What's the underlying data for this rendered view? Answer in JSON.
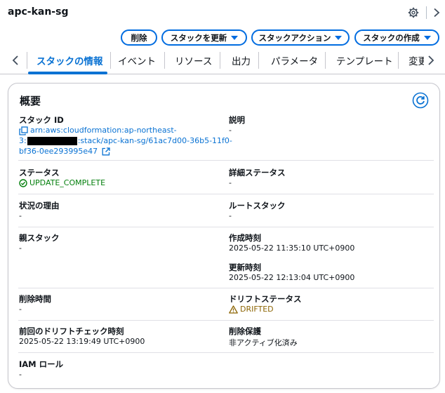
{
  "header": {
    "title": "apc-kan-sg",
    "settings_icon": "gear-icon",
    "next_icon": "chevron-right-icon"
  },
  "actions": {
    "delete": "削除",
    "update": "スタックを更新",
    "stack_actions": "スタックアクション",
    "create": "スタックの作成"
  },
  "tabs": [
    {
      "label": "スタックの情報"
    },
    {
      "label": "イベント"
    },
    {
      "label": "リソース"
    },
    {
      "label": "出力"
    },
    {
      "label": "パラメータ"
    },
    {
      "label": "テンプレート"
    },
    {
      "label": "変更"
    }
  ],
  "overview": {
    "title": "概要",
    "stack_id_label": "スタック ID",
    "stack_id_line1": "arn:aws:cloudformation:ap-northeast-",
    "stack_id_line2_prefix": "3:",
    "stack_id_line2_suffix": ":stack/apc-kan-sg/61ac7d00-36b5-11f0-",
    "stack_id_line3": "bf36-0ee293995e47",
    "description_label": "説明",
    "description_value": "-",
    "status_label": "ステータス",
    "status_value": "UPDATE_COMPLETE",
    "detailed_status_label": "詳細ステータス",
    "detailed_status_value": "-",
    "reason_label": "状況の理由",
    "reason_value": "-",
    "root_stack_label": "ルートスタック",
    "root_stack_value": "-",
    "parent_stack_label": "親スタック",
    "parent_stack_value": "-",
    "created_label": "作成時刻",
    "created_value": "2025-05-22 11:35:10 UTC+0900",
    "updated_label": "更新時刻",
    "updated_value": "2025-05-22 12:13:04 UTC+0900",
    "deleted_label": "削除時間",
    "deleted_value": "-",
    "drift_status_label": "ドリフトステータス",
    "drift_status_value": "DRIFTED",
    "last_drift_label": "前回のドリフトチェック時刻",
    "last_drift_value": "2025-05-22 13:19:49 UTC+0900",
    "termination_label": "削除保護",
    "termination_value": "非アクティブ化済み",
    "iam_label": "IAM ロール",
    "iam_value": "-"
  },
  "colors": {
    "accent": "#0972d3",
    "success": "#037f0c",
    "warning": "#8d6605"
  }
}
